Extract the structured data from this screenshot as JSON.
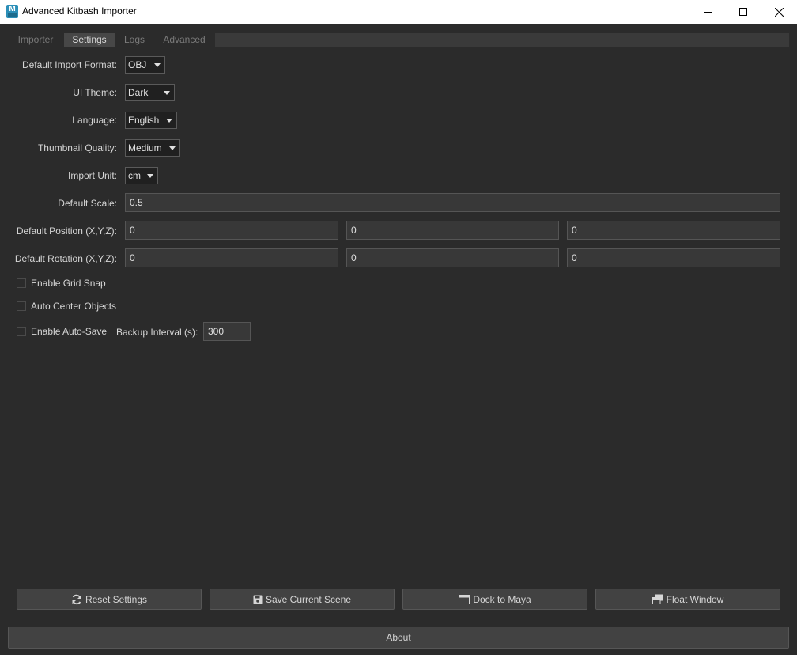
{
  "window": {
    "title": "Advanced Kitbash Importer",
    "icon_letter": "M"
  },
  "tabs": [
    {
      "label": "Importer",
      "active": false
    },
    {
      "label": "Settings",
      "active": true
    },
    {
      "label": "Logs",
      "active": false
    },
    {
      "label": "Advanced",
      "active": false
    }
  ],
  "settings": {
    "import_format": {
      "label": "Default Import Format:",
      "value": "OBJ"
    },
    "ui_theme": {
      "label": "UI Theme:",
      "value": "Dark"
    },
    "language": {
      "label": "Language:",
      "value": "English"
    },
    "thumbnail_quality": {
      "label": "Thumbnail Quality:",
      "value": "Medium"
    },
    "import_unit": {
      "label": "Import Unit:",
      "value": "cm"
    },
    "default_scale": {
      "label": "Default Scale:",
      "value": "0.5"
    },
    "default_position": {
      "label": "Default Position (X,Y,Z):",
      "x": "0",
      "y": "0",
      "z": "0"
    },
    "default_rotation": {
      "label": "Default Rotation (X,Y,Z):",
      "x": "0",
      "y": "0",
      "z": "0"
    },
    "grid_snap": {
      "label": "Enable Grid Snap",
      "checked": false
    },
    "auto_center": {
      "label": "Auto Center Objects",
      "checked": false
    },
    "auto_save": {
      "label": "Enable Auto-Save",
      "checked": false
    },
    "backup_interval": {
      "label": "Backup Interval (s):",
      "value": "300"
    }
  },
  "buttons": {
    "reset": "Reset Settings",
    "save_scene": "Save Current Scene",
    "dock": "Dock to Maya",
    "float": "Float Window",
    "about": "About"
  },
  "icons": {
    "reset": "refresh-icon",
    "save_scene": "floppy-disk-icon",
    "dock": "dock-window-icon",
    "float": "float-windows-icon"
  },
  "colors": {
    "background": "#2b2b2b",
    "field": "#383838",
    "button": "#424242",
    "active_tab": "#474747"
  }
}
